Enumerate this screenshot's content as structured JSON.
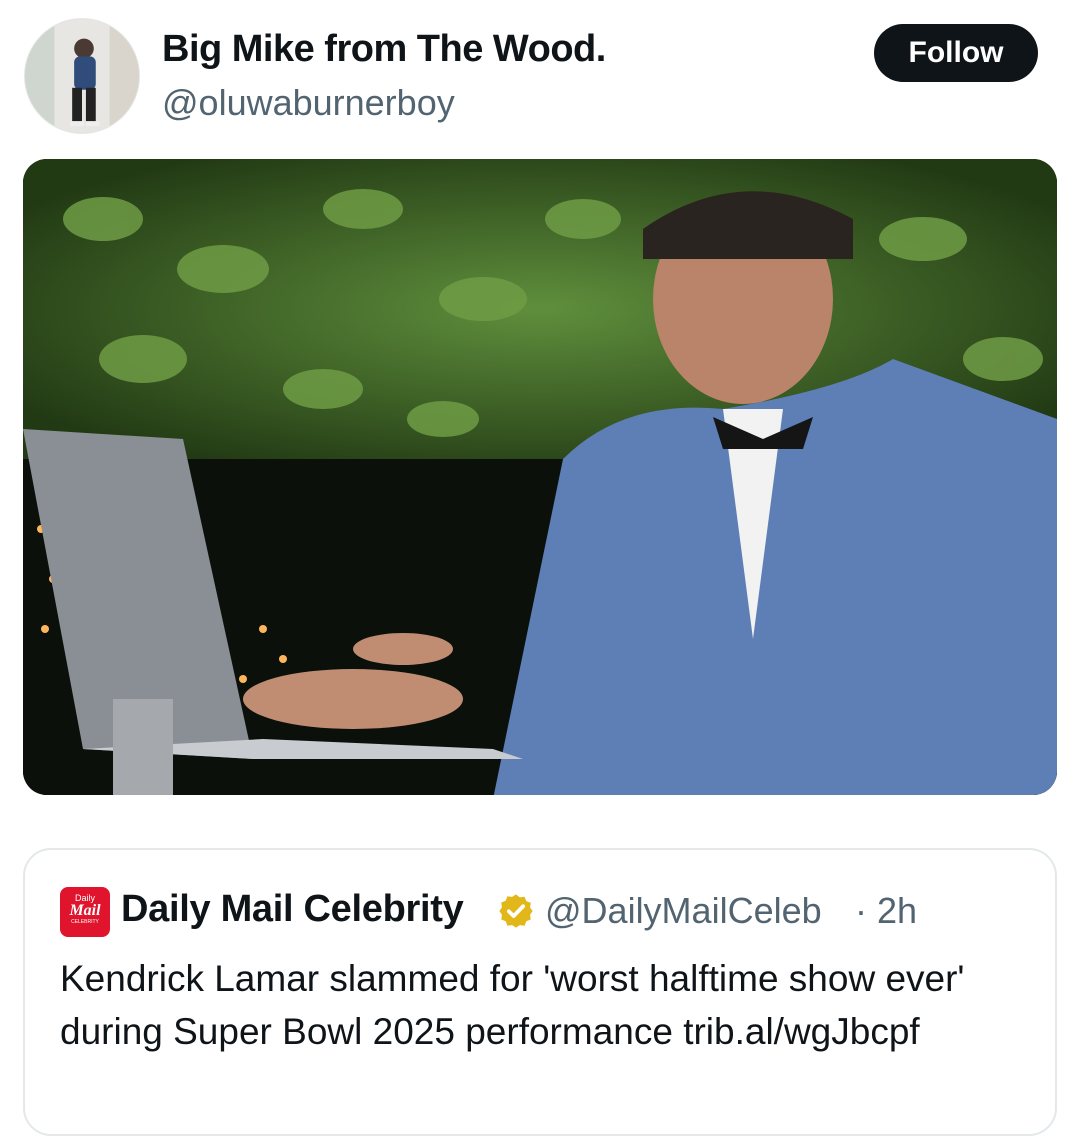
{
  "author": {
    "display_name": "Big Mike from The Wood.",
    "handle": "@oluwaburnerboy",
    "follow_label": "Follow"
  },
  "media": {
    "description_icon": "photo-icon"
  },
  "quoted_tweet": {
    "logo": {
      "line1": "Daily",
      "line2": "Mail",
      "line3": "CELEBRITY"
    },
    "source_name": "Daily Mail Celebrity",
    "handle": "@DailyMailCeleb",
    "separator": "·",
    "time": "2h",
    "text": "Kendrick Lamar slammed for 'worst halftime show ever' during Super Bowl 2025 performance trib.al/wgJbcpf"
  },
  "colors": {
    "follow_bg": "#0f1419",
    "muted_text": "#536471",
    "verified_gold": "#e2b719",
    "logo_red": "#e0142d"
  }
}
